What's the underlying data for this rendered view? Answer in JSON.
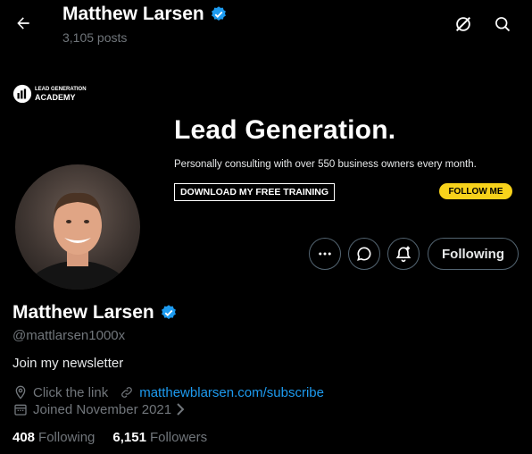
{
  "header": {
    "name": "Matthew Larsen",
    "posts": "3,105 posts"
  },
  "banner": {
    "logo_line1": "LEAD GENERATION",
    "logo_line2": "ACADEMY",
    "headline": "Lead Generation.",
    "subline": "Personally consulting with over 550 business owners every month.",
    "download_label": "DOWNLOAD MY FREE TRAINING",
    "follow_me_label": "FOLLOW ME"
  },
  "actions": {
    "following_label": "Following"
  },
  "profile": {
    "name": "Matthew Larsen",
    "handle": "@mattlarsen1000x",
    "bio": "Join my newsletter",
    "location": "Click the link",
    "website": "matthewblarsen.com/subscribe",
    "joined": "Joined November 2021",
    "following_count": "408",
    "following_label": "Following",
    "followers_count": "6,151",
    "followers_label": "Followers"
  },
  "icons": {
    "back": "back-arrow-icon",
    "grok": "grok-icon",
    "search": "search-icon",
    "more": "more-icon",
    "message": "message-icon",
    "notify": "notification-bell-icon",
    "verified": "verified-badge-icon",
    "location": "location-icon",
    "link": "link-icon",
    "calendar": "calendar-icon"
  },
  "colors": {
    "background": "#000000",
    "accent": "#1d9bf0",
    "muted": "#71767b",
    "banner_button": "#f7d21b"
  }
}
